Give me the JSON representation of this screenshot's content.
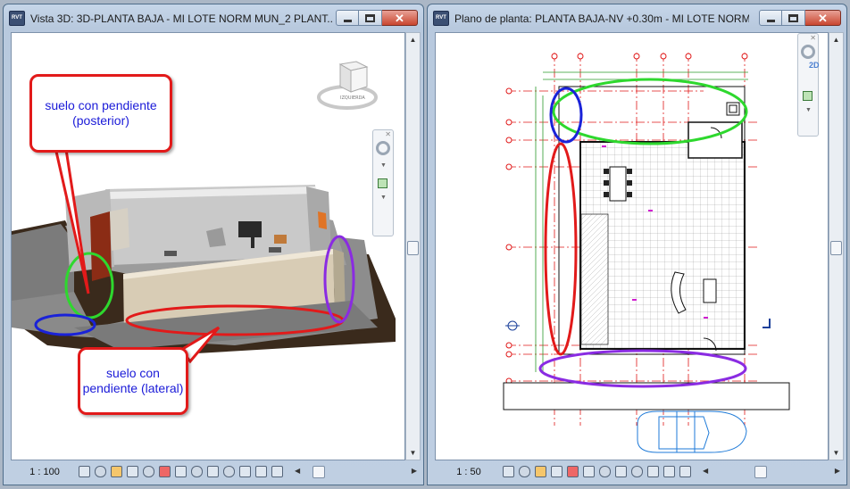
{
  "window_3d": {
    "title": "Vista 3D: 3D-PLANTA BAJA - MI LOTE NORM MUN_2 PLANT...",
    "app_badge": "RVT",
    "scale": "1 : 100",
    "viewcube_label": "IZQUIERDA",
    "callout_top": "suelo con pendiente (posterior)",
    "callout_bottom": "suelo con pendiente (lateral)"
  },
  "window_plan": {
    "title": "Plano de planta: PLANTA BAJA-NV +0.30m - MI LOTE NORM ...",
    "app_badge": "RVT",
    "scale": "1 : 50",
    "nav_2d_label": "2D"
  },
  "caption_buttons": {
    "minimize": "minimize-icon",
    "maximize": "maximize-icon",
    "close": "✕"
  },
  "colors": {
    "annotation_red": "#e21a1a",
    "annotation_green": "#2ed82e",
    "annotation_blue": "#1a22d8",
    "annotation_purple": "#8a2be2",
    "callout_text": "#1a1ad8"
  }
}
